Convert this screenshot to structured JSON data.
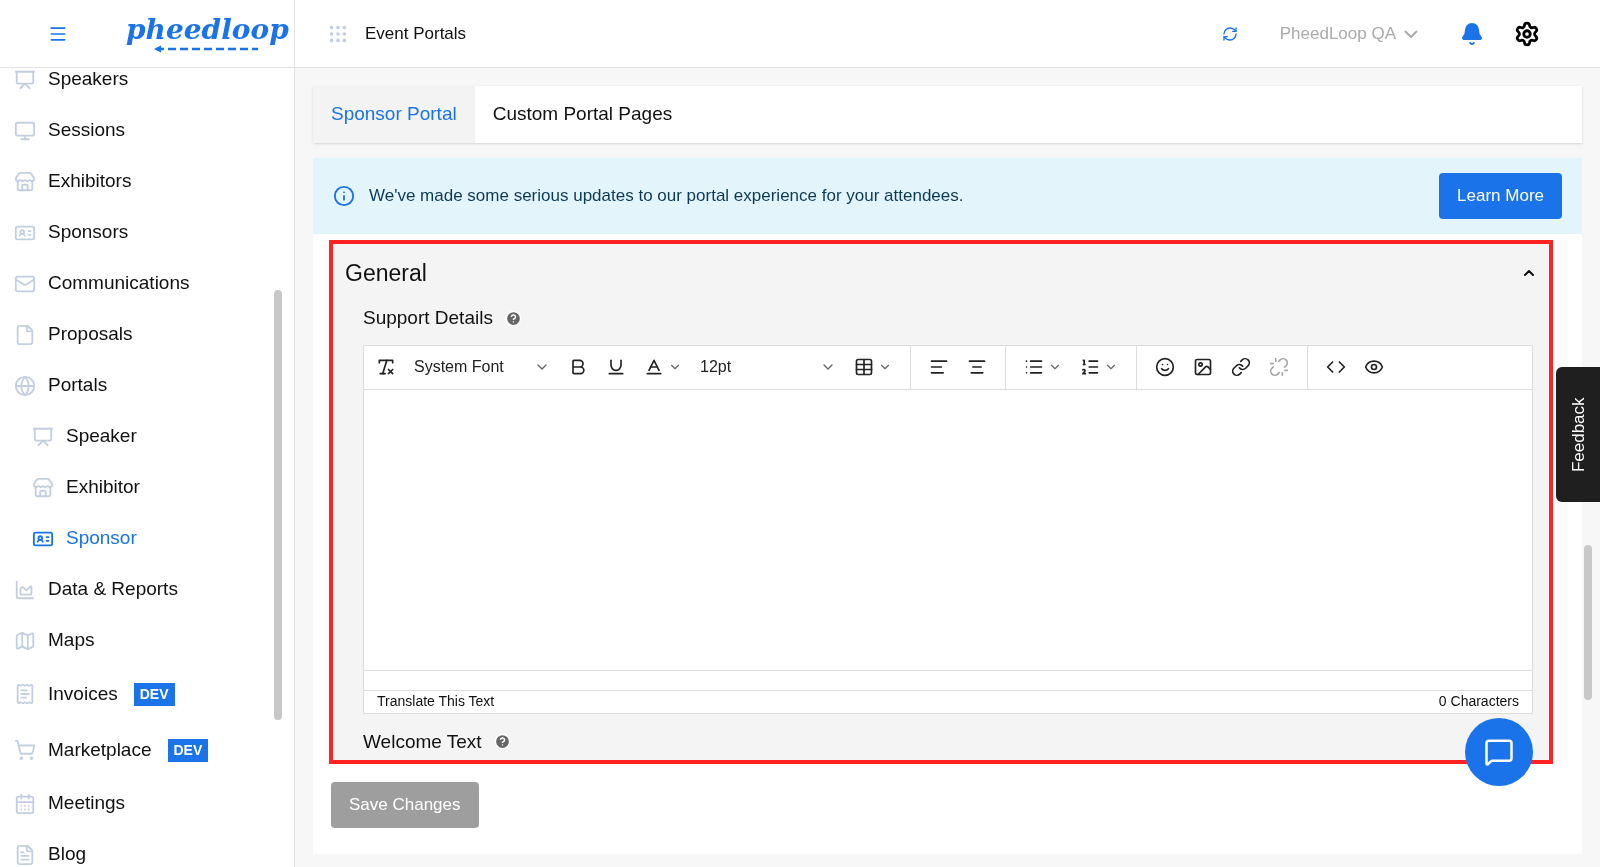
{
  "header": {
    "logo": "pheedloop",
    "title": "Event Portals",
    "account": "PheedLoop QA"
  },
  "sidebar": {
    "items": [
      {
        "label": "Speakers",
        "selected": false
      },
      {
        "label": "Sessions",
        "selected": false
      },
      {
        "label": "Exhibitors",
        "selected": false
      },
      {
        "label": "Sponsors",
        "selected": false
      },
      {
        "label": "Communications",
        "selected": false
      },
      {
        "label": "Proposals",
        "selected": false
      },
      {
        "label": "Portals",
        "selected": false,
        "children": [
          {
            "label": "Speaker",
            "selected": false
          },
          {
            "label": "Exhibitor",
            "selected": false
          },
          {
            "label": "Sponsor",
            "selected": true
          }
        ]
      },
      {
        "label": "Data & Reports",
        "selected": false
      },
      {
        "label": "Maps",
        "selected": false
      },
      {
        "label": "Invoices",
        "selected": false,
        "badge": "DEV"
      },
      {
        "label": "Marketplace",
        "selected": false,
        "badge": "DEV"
      },
      {
        "label": "Meetings",
        "selected": false
      },
      {
        "label": "Blog",
        "selected": false
      }
    ]
  },
  "tabs": [
    {
      "label": "Sponsor Portal",
      "selected": true
    },
    {
      "label": "Custom Portal Pages",
      "selected": false
    }
  ],
  "banner": {
    "message": "We've made some serious updates to our portal experience for your attendees.",
    "button": "Learn More"
  },
  "section": {
    "title": "General",
    "expanded": true,
    "highlighted": true,
    "fields": [
      {
        "label": "Support Details",
        "editor": {
          "font": "System Font",
          "size": "12pt",
          "footer_left": "Translate This Text",
          "footer_right": "0 Characters"
        }
      },
      {
        "label": "Welcome Text"
      }
    ]
  },
  "save_button": {
    "label": "Save Changes",
    "disabled": true
  },
  "feedback_tab": "Feedback"
}
